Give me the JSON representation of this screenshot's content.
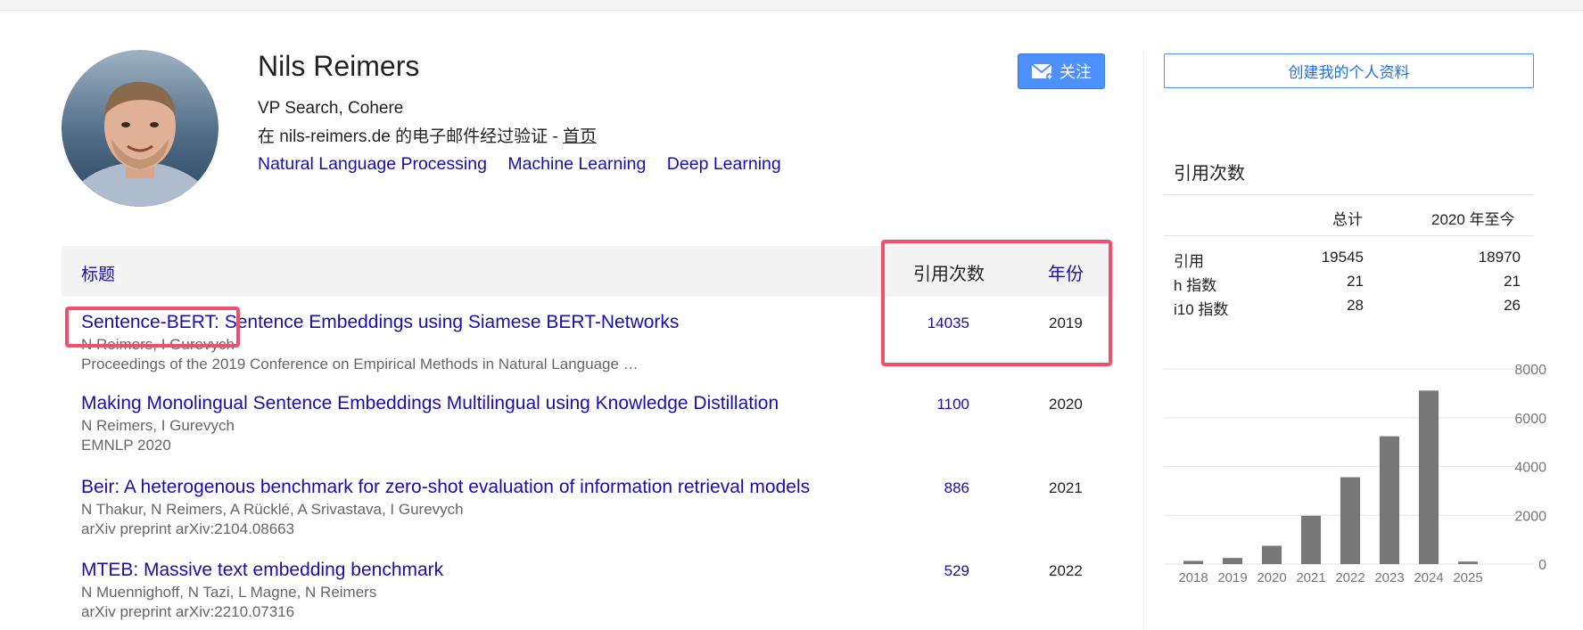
{
  "profile": {
    "name": "Nils Reimers",
    "affiliation": "VP Search, Cohere",
    "email_prefix": "在 nils-reimers.de 的电子邮件经过验证 - ",
    "homepage_label": "首页",
    "interests": [
      "Natural Language Processing",
      "Machine Learning",
      "Deep Learning"
    ],
    "follow_label": "关注",
    "create_profile_label": "创建我的个人资料"
  },
  "table": {
    "header_title": "标题",
    "header_citations": "引用次数",
    "header_year": "年份",
    "rows": [
      {
        "title": "Sentence-BERT: Sentence Embeddings using Siamese BERT-Networks",
        "authors": "N Reimers, I Gurevych",
        "venue": "Proceedings of the 2019 Conference on Empirical Methods in Natural Language …",
        "citations": "14035",
        "year": "2019"
      },
      {
        "title": "Making Monolingual Sentence Embeddings Multilingual using Knowledge Distillation",
        "authors": "N Reimers, I Gurevych",
        "venue": "EMNLP 2020",
        "citations": "1100",
        "year": "2020"
      },
      {
        "title": "Beir: A heterogenous benchmark for zero-shot evaluation of information retrieval models",
        "authors": "N Thakur, N Reimers, A Rücklé, A Srivastava, I Gurevych",
        "venue": "arXiv preprint arXiv:2104.08663",
        "citations": "886",
        "year": "2021"
      },
      {
        "title": "MTEB: Massive text embedding benchmark",
        "authors": "N Muennighoff, N Tazi, L Magne, N Reimers",
        "venue": "arXiv preprint arXiv:2210.07316",
        "citations": "529",
        "year": "2022"
      }
    ]
  },
  "sidebar": {
    "title": "引用次数",
    "col_total": "总计",
    "col_since": "2020 年至今",
    "stats": [
      {
        "label": "引用",
        "total": "19545",
        "since": "18970"
      },
      {
        "label": "h 指数",
        "total": "21",
        "since": "21"
      },
      {
        "label": "i10 指数",
        "total": "28",
        "since": "26"
      }
    ]
  },
  "chart_data": {
    "type": "bar",
    "categories": [
      "2018",
      "2019",
      "2020",
      "2021",
      "2022",
      "2023",
      "2024",
      "2025"
    ],
    "values": [
      130,
      250,
      750,
      1980,
      3560,
      5240,
      7110,
      100
    ],
    "ylim": [
      0,
      8000
    ],
    "yticks": [
      "8000",
      "6000",
      "4000",
      "2000",
      "0"
    ],
    "bar_color": "#777777"
  },
  "colors": {
    "link": "#1a0dab",
    "highlight": "#f0506e",
    "button": "#4d90fe"
  }
}
